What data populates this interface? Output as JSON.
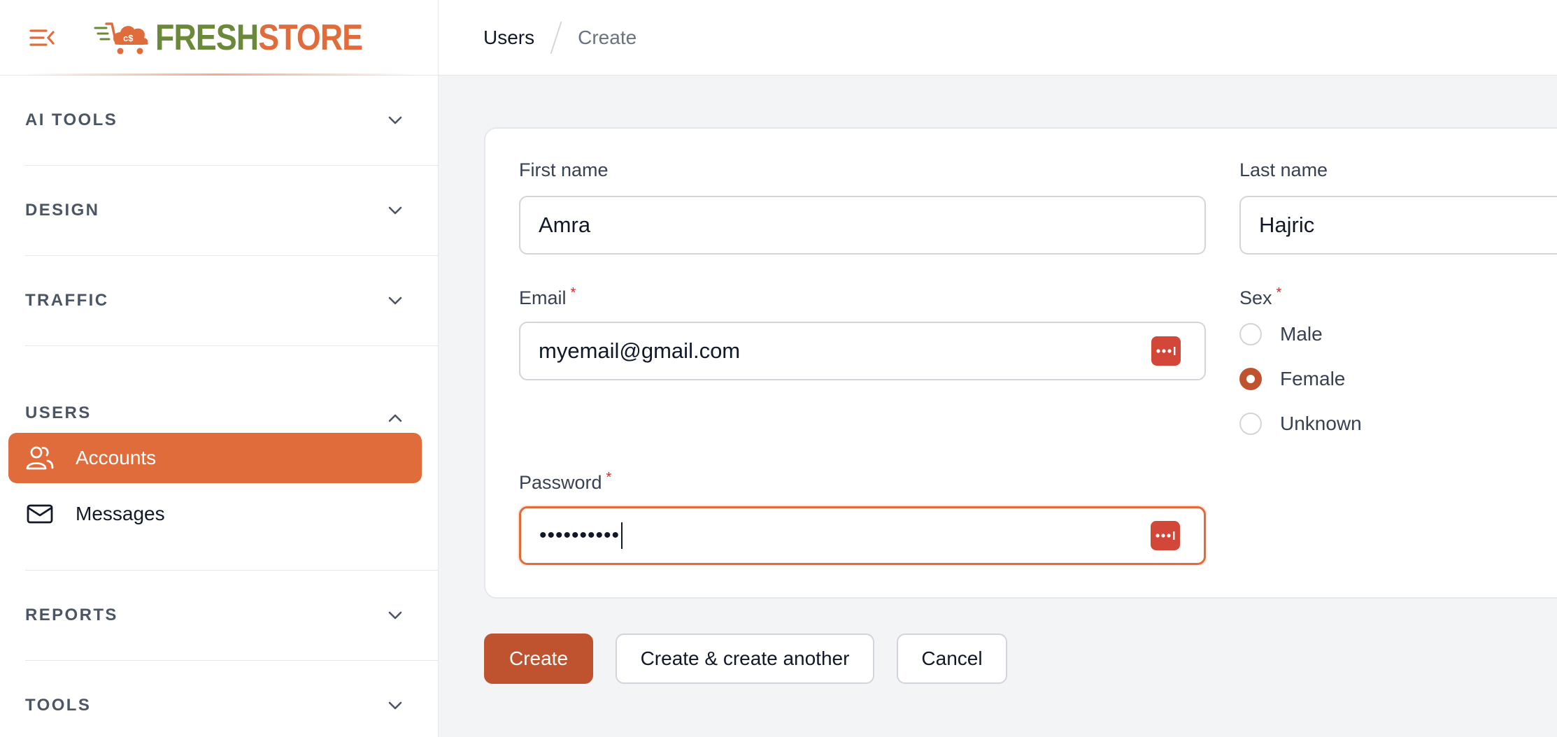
{
  "brand": {
    "name_part1": "FRESH",
    "name_part2": "STORE",
    "accent": "#e06c3c",
    "green": "#6a8a3a"
  },
  "breadcrumb": {
    "parent": "Users",
    "current": "Create"
  },
  "sidebar": {
    "groups": [
      {
        "label": "AI TOOLS",
        "icon": "chevron-down-icon"
      },
      {
        "label": "DESIGN",
        "icon": "chevron-down-icon"
      },
      {
        "label": "TRAFFIC",
        "icon": "chevron-down-icon"
      },
      {
        "label": "USERS",
        "icon": "chevron-up-icon",
        "expanded": true,
        "items": [
          {
            "label": "Accounts",
            "icon": "users-icon",
            "active": true
          },
          {
            "label": "Messages",
            "icon": "envelope-icon",
            "active": false
          }
        ]
      },
      {
        "label": "REPORTS",
        "icon": "chevron-down-icon"
      },
      {
        "label": "TOOLS",
        "icon": "chevron-down-icon"
      }
    ]
  },
  "form": {
    "first_name": {
      "label": "First name",
      "value": "Amra"
    },
    "last_name": {
      "label": "Last name",
      "value": "Hajric"
    },
    "email": {
      "label": "Email",
      "required_mark": "*",
      "value": "myemail@gmail.com"
    },
    "sex": {
      "label": "Sex",
      "required_mark": "*",
      "options": [
        "Male",
        "Female",
        "Unknown"
      ],
      "selected": "Female"
    },
    "password": {
      "label": "Password",
      "required_mark": "*",
      "value_masked": "••••••••••"
    }
  },
  "actions": {
    "create": "Create",
    "create_another": "Create & create another",
    "cancel": "Cancel"
  }
}
